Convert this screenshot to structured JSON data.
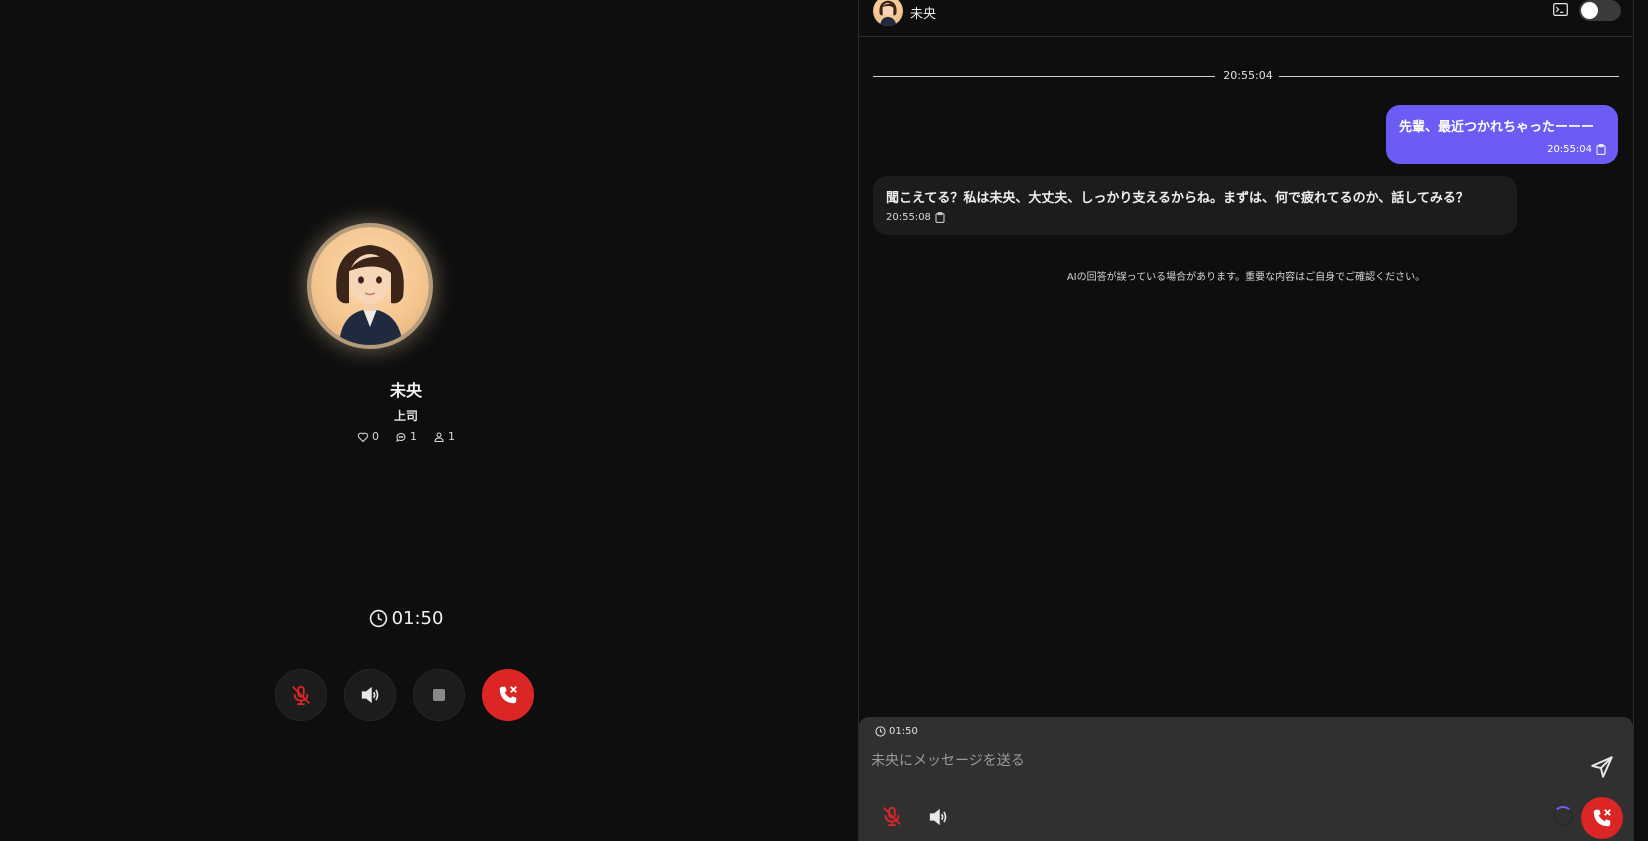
{
  "caller": {
    "name": "未央",
    "role": "上司",
    "stats": {
      "likes": "0",
      "comments": "1",
      "users": "1"
    }
  },
  "call": {
    "timer": "01:50"
  },
  "chat": {
    "header_name": "未央",
    "toggle_on": false,
    "date_divider": "20:55:04",
    "messages": [
      {
        "role": "user",
        "text": "先輩、最近つかれちゃったーーー",
        "time": "20:55:04"
      },
      {
        "role": "ai",
        "text": "聞こえてる？私は未央、大丈夫、しっかり支えるからね。まずは、何で疲れてるのか、話してみる？",
        "time": "20:55:08"
      }
    ],
    "disclaimer": "AIの回答が誤っている場合があります。重要な内容はご自身でご確認ください。",
    "input": {
      "timer": "01:50",
      "placeholder": "未央にメッセージを送る"
    }
  },
  "colors": {
    "accent": "#6b5cf6",
    "end_call": "#dc2626",
    "mic_muted": "#dc2626"
  },
  "icons": [
    "clock-icon",
    "heart-icon",
    "comment-icon",
    "user-icon",
    "mic-off-icon",
    "speaker-icon",
    "stop-icon",
    "phone-end-icon",
    "terminal-icon",
    "clipboard-icon",
    "send-icon"
  ]
}
